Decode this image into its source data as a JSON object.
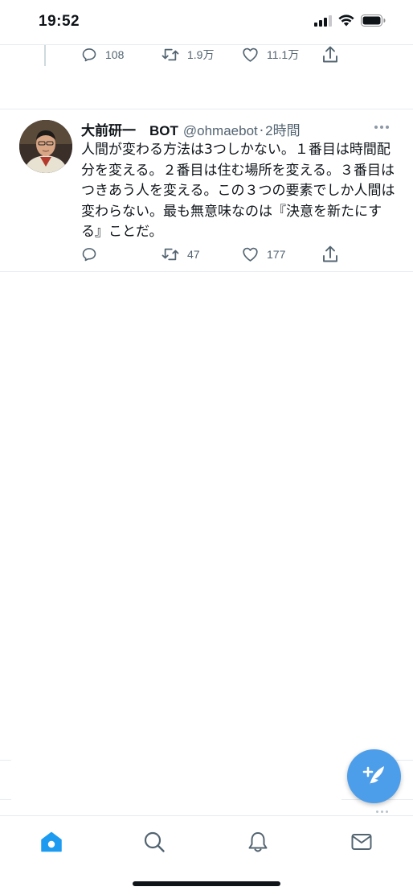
{
  "status_bar": {
    "time": "19:52",
    "icons": [
      "cellular-signal-icon",
      "wifi-icon",
      "battery-icon"
    ]
  },
  "previous_tweet": {
    "reply_count": "108",
    "retweet_count": "1.9万",
    "like_count": "11.1万",
    "icons": [
      "reply-icon",
      "retweet-icon",
      "like-icon",
      "share-icon"
    ]
  },
  "tweet": {
    "display_name": "大前研一　BOT",
    "handle": "@ohmaebot",
    "separator": "·",
    "time": "2時間",
    "text": "人間が変わる方法は3つしかない。１番目は時間配分を変える。２番目は住む場所を変える。３番目はつきあう人を変える。この３つの要素でしか人間は変わらない。最も無意味なのは『決意を新たにする』ことだ。",
    "reply_count": "",
    "retweet_count": "47",
    "like_count": "177",
    "icons": [
      "reply-icon",
      "retweet-icon",
      "like-icon",
      "share-icon",
      "more-icon"
    ]
  },
  "fab": {
    "icon": "compose-tweet-icon"
  },
  "tab_bar": {
    "tabs": [
      {
        "name": "home",
        "icon": "home-icon",
        "active": true
      },
      {
        "name": "search",
        "icon": "search-icon",
        "active": false
      },
      {
        "name": "notifications",
        "icon": "bell-icon",
        "active": false
      },
      {
        "name": "messages",
        "icon": "mail-icon",
        "active": false
      }
    ]
  },
  "colors": {
    "accent": "#1d9bf0",
    "fab": "#4d9eea",
    "secondary_text": "#536471",
    "divider": "#e6ecf0",
    "primary_text": "#0f1419"
  }
}
